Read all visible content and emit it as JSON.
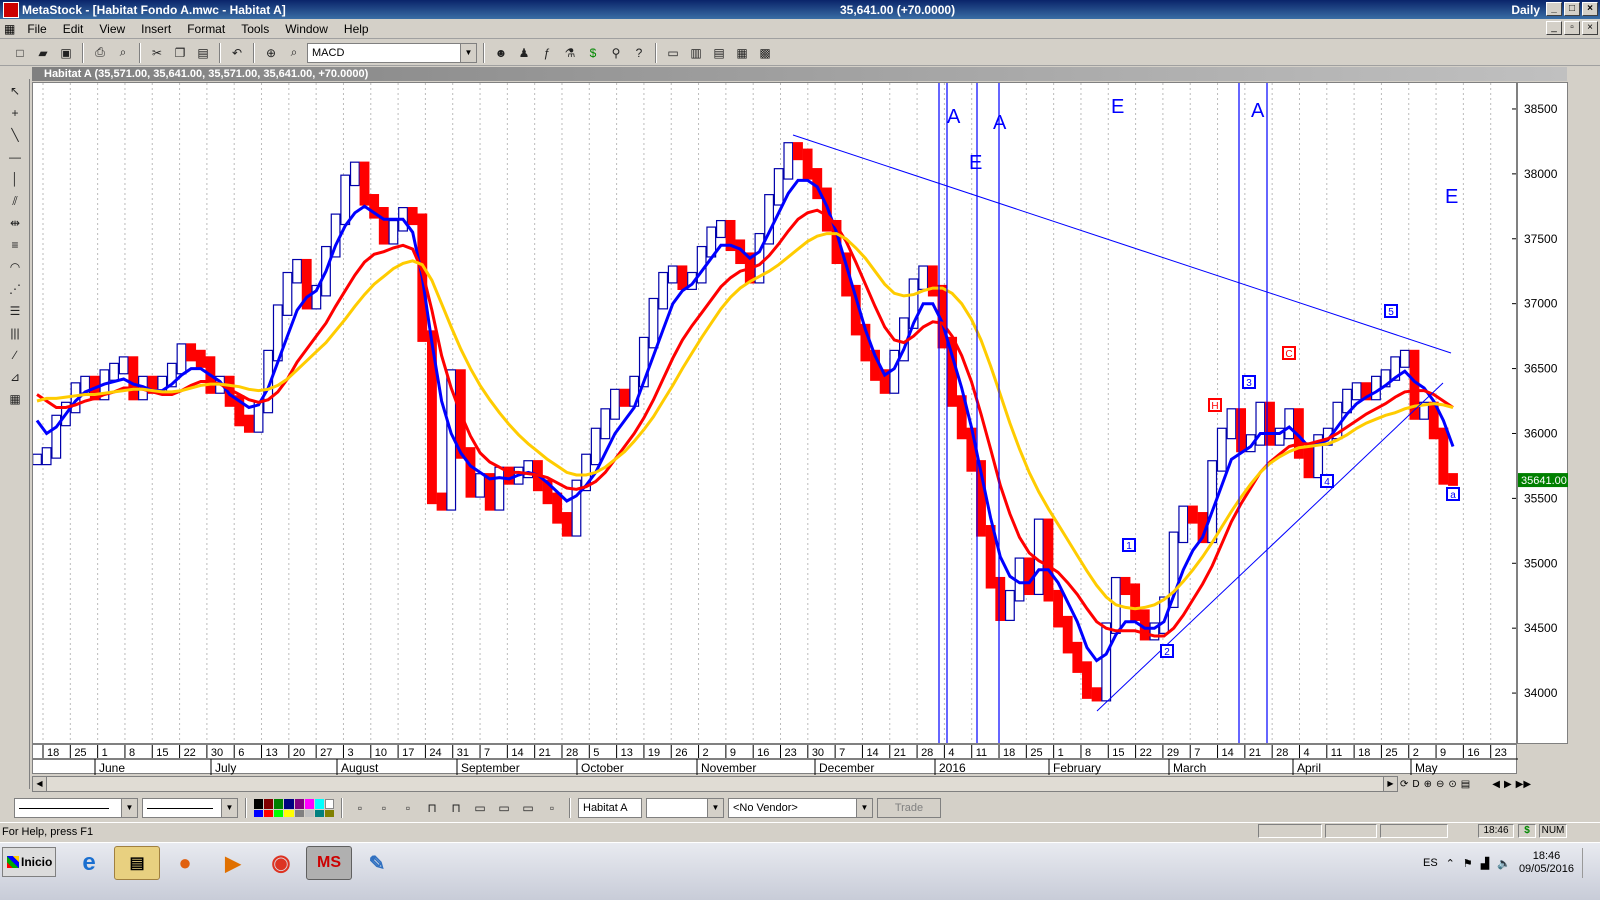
{
  "window": {
    "title": "MetaStock - [Habitat Fondo A.mwc - Habitat A]",
    "center_title": "35,641.00 (+70.0000)",
    "periodicity": "Daily"
  },
  "menu": [
    "File",
    "Edit",
    "View",
    "Insert",
    "Format",
    "Tools",
    "Window",
    "Help"
  ],
  "toolbar": {
    "indicator_combo": "MACD"
  },
  "chart_window": {
    "title": "Habitat A (35,571.00, 35,641.00, 35,571.00, 35,641.00, +70.0000)"
  },
  "chart_data": {
    "type": "line",
    "security": "Habitat A",
    "last_value": "35641.00",
    "ylim": [
      33600,
      38700
    ],
    "y_ticks": [
      34000,
      34500,
      35000,
      35500,
      36000,
      36500,
      37000,
      37500,
      38000,
      38500
    ],
    "y_tick_labels": [
      "34000",
      "34500",
      "35000",
      "35500",
      "36000",
      "36500",
      "37000",
      "37500",
      "38000",
      "38500"
    ],
    "x_day_labels": [
      "18",
      "25",
      "1",
      "8",
      "15",
      "22",
      "30",
      "6",
      "13",
      "20",
      "27",
      "3",
      "10",
      "17",
      "24",
      "31",
      "7",
      "14",
      "21",
      "28",
      "5",
      "13",
      "19",
      "26",
      "2",
      "9",
      "16",
      "23",
      "30",
      "7",
      "14",
      "21",
      "28",
      "4",
      "11",
      "18",
      "25",
      "1",
      "8",
      "15",
      "22",
      "29",
      "7",
      "14",
      "21",
      "28",
      "4",
      "11",
      "18",
      "25",
      "2",
      "9",
      "16",
      "23"
    ],
    "x_month_labels": [
      "June",
      "July",
      "August",
      "September",
      "October",
      "November",
      "December",
      "2016",
      "February",
      "March",
      "April",
      "May"
    ],
    "annotations": [
      "A",
      "A",
      "E",
      "E",
      "A",
      "E",
      "1",
      "2",
      "3",
      "4",
      "5",
      "a",
      "H",
      "C"
    ],
    "series": [
      {
        "name": "Price",
        "color": "#0000cc",
        "values": [
          35800,
          35850,
          36100,
          36200,
          36350,
          36400,
          36300,
          36450,
          36500,
          36550,
          36300,
          36400,
          36350,
          36400,
          36500,
          36650,
          36600,
          36550,
          36350,
          36400,
          36250,
          36100,
          36050,
          36200,
          36600,
          36950,
          37200,
          37300,
          37000,
          37100,
          37400,
          37650,
          37950,
          38050,
          37800,
          37700,
          37500,
          37600,
          37700,
          37650,
          36750,
          35500,
          35450,
          36450,
          35850,
          35550,
          35650,
          35450,
          35700,
          35650,
          35700,
          35750,
          35600,
          35500,
          35350,
          35250,
          35600,
          35800,
          36000,
          36150,
          36300,
          36250,
          36400,
          36700,
          37000,
          37200,
          37250,
          37150,
          37200,
          37400,
          37550,
          37600,
          37450,
          37350,
          37200,
          37500,
          37800,
          38000,
          38200,
          38150,
          38000,
          37850,
          37600,
          37350,
          37100,
          36800,
          36600,
          36450,
          36350,
          36600,
          36850,
          37150,
          37250,
          37100,
          36700,
          36250,
          36000,
          35750,
          35250,
          34850,
          34600,
          34750,
          35000,
          34800,
          35300,
          34750,
          34550,
          34350,
          34200,
          34000,
          33980,
          34500,
          34850,
          34800,
          34600,
          34450,
          34500,
          34700,
          35200,
          35400,
          35350,
          35200,
          35750,
          36000,
          36150,
          35900,
          35950,
          36200,
          35950,
          36000,
          36150,
          35850,
          35700,
          35950,
          36000,
          36200,
          36300,
          36350,
          36300,
          36400,
          36450,
          36550,
          36600,
          36150,
          36200,
          36000,
          35650,
          35641
        ]
      },
      {
        "name": "Blue MA",
        "color": "#0000ff",
        "values": [
          36100,
          36000,
          36050,
          36150,
          36250,
          36320,
          36350,
          36380,
          36400,
          36420,
          36380,
          36360,
          36330,
          36330,
          36380,
          36450,
          36500,
          36500,
          36450,
          36400,
          36300,
          36250,
          36200,
          36220,
          36350,
          36550,
          36750,
          36950,
          37050,
          37100,
          37250,
          37450,
          37600,
          37700,
          37750,
          37700,
          37650,
          37650,
          37650,
          37550,
          37200,
          36700,
          36250,
          36000,
          35850,
          35750,
          35700,
          35650,
          35660,
          35650,
          35680,
          35700,
          35680,
          35620,
          35550,
          35480,
          35520,
          35600,
          35700,
          35850,
          36000,
          36100,
          36200,
          36400,
          36600,
          36800,
          37000,
          37100,
          37150,
          37250,
          37350,
          37450,
          37450,
          37420,
          37350,
          37400,
          37550,
          37700,
          37850,
          37950,
          37950,
          37900,
          37750,
          37550,
          37300,
          37050,
          36800,
          36600,
          36450,
          36500,
          36650,
          36850,
          37000,
          37000,
          36850,
          36600,
          36350,
          36050,
          35700,
          35350,
          35050,
          34900,
          34850,
          34850,
          34950,
          34950,
          34850,
          34700,
          34550,
          34350,
          34250,
          34300,
          34450,
          34550,
          34550,
          34500,
          34500,
          34550,
          34750,
          34950,
          35100,
          35200,
          35400,
          35600,
          35800,
          35850,
          35900,
          36000,
          36000,
          36000,
          36050,
          35980,
          35900,
          35920,
          35950,
          36050,
          36150,
          36230,
          36280,
          36320,
          36370,
          36430,
          36480,
          36400,
          36350,
          36250,
          36100,
          35900
        ]
      },
      {
        "name": "Red MA",
        "color": "#ff0000",
        "values": [
          36300,
          36250,
          36200,
          36200,
          36220,
          36250,
          36270,
          36300,
          36320,
          36350,
          36350,
          36340,
          36320,
          36300,
          36300,
          36330,
          36370,
          36400,
          36400,
          36380,
          36340,
          36300,
          36260,
          36240,
          36260,
          36320,
          36420,
          36550,
          36650,
          36750,
          36850,
          36980,
          37100,
          37220,
          37320,
          37380,
          37400,
          37430,
          37450,
          37420,
          37250,
          36950,
          36600,
          36350,
          36150,
          35980,
          35850,
          35780,
          35740,
          35700,
          35700,
          35690,
          35680,
          35660,
          35620,
          35580,
          35570,
          35590,
          35630,
          35700,
          35800,
          35900,
          36000,
          36120,
          36260,
          36420,
          36580,
          36720,
          36830,
          36930,
          37030,
          37130,
          37200,
          37250,
          37270,
          37300,
          37370,
          37460,
          37560,
          37650,
          37700,
          37720,
          37680,
          37600,
          37480,
          37320,
          37150,
          36980,
          36820,
          36720,
          36700,
          36750,
          36820,
          36860,
          36850,
          36750,
          36600,
          36400,
          36150,
          35880,
          35600,
          35380,
          35200,
          35080,
          35020,
          34980,
          34930,
          34850,
          34760,
          34650,
          34550,
          34500,
          34480,
          34480,
          34480,
          34460,
          34440,
          34440,
          34500,
          34600,
          34720,
          34840,
          34980,
          35150,
          35320,
          35460,
          35580,
          35700,
          35780,
          35840,
          35900,
          35920,
          35920,
          35940,
          35960,
          36000,
          36050,
          36100,
          36150,
          36190,
          36230,
          36280,
          36320,
          36330,
          36330,
          36300,
          36250,
          36200
        ]
      },
      {
        "name": "Yellow MA",
        "color": "#ffcc00",
        "values": [
          36250,
          36270,
          36270,
          36280,
          36290,
          36300,
          36300,
          36310,
          36320,
          36330,
          36340,
          36340,
          36330,
          36320,
          36320,
          36330,
          36350,
          36370,
          36380,
          36380,
          36370,
          36360,
          36340,
          36330,
          36340,
          36370,
          36420,
          36490,
          36560,
          36630,
          36700,
          36790,
          36880,
          36980,
          37070,
          37150,
          37210,
          37270,
          37310,
          37330,
          37300,
          37180,
          37000,
          36820,
          36650,
          36500,
          36370,
          36260,
          36160,
          36070,
          35990,
          35920,
          35860,
          35800,
          35750,
          35700,
          35680,
          35680,
          35700,
          35740,
          35800,
          35860,
          35940,
          36030,
          36130,
          36250,
          36370,
          36500,
          36620,
          36740,
          36850,
          36960,
          37050,
          37120,
          37170,
          37210,
          37250,
          37300,
          37360,
          37420,
          37480,
          37520,
          37540,
          37540,
          37500,
          37430,
          37350,
          37250,
          37150,
          37080,
          37060,
          37070,
          37100,
          37120,
          37120,
          37080,
          37000,
          36880,
          36720,
          36520,
          36300,
          36080,
          35880,
          35700,
          35550,
          35420,
          35300,
          35180,
          35060,
          34940,
          34830,
          34740,
          34680,
          34660,
          34650,
          34660,
          34680,
          34720,
          34780,
          34860,
          34950,
          35050,
          35160,
          35280,
          35400,
          35510,
          35610,
          35700,
          35770,
          35820,
          35860,
          35890,
          35900,
          35910,
          35920,
          35950,
          35990,
          36040,
          36080,
          36110,
          36140,
          36160,
          36190,
          36210,
          36220,
          36230,
          36220,
          36200
        ]
      }
    ]
  },
  "bottom_toolbar": {
    "security_combo": "Habitat A",
    "vendor_combo": "<No Vendor>",
    "trade_button": "Trade"
  },
  "status": {
    "help_text": "For Help, press F1",
    "time": "18:46",
    "num": "NUM"
  },
  "taskbar": {
    "start_label": "Inicio",
    "lang": "ES",
    "clock_time": "18:46",
    "clock_date": "09/05/2016"
  }
}
